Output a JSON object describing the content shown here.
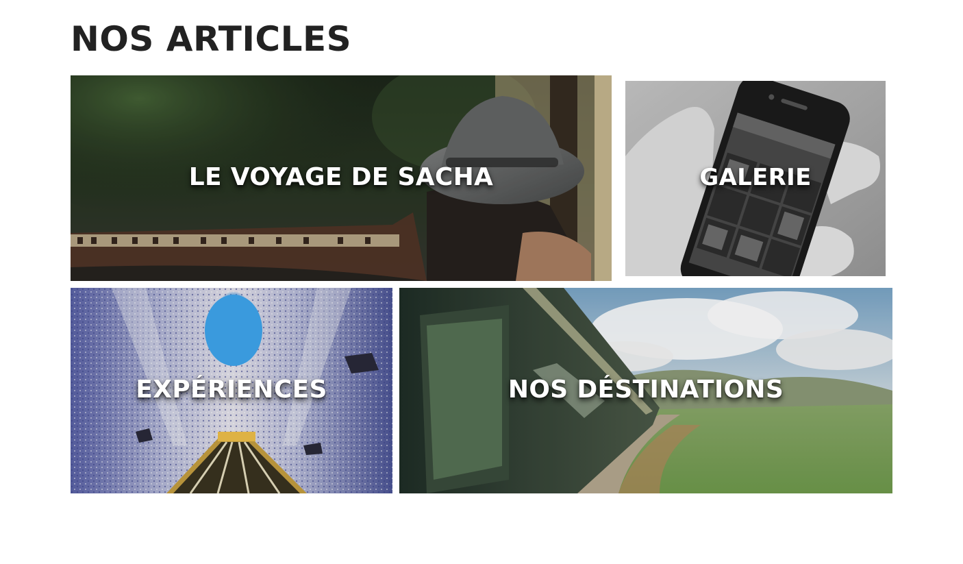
{
  "page": {
    "section_title": "NOS ARTICLES"
  },
  "articles": [
    {
      "label": "LE VOYAGE DE SACHA",
      "image": "woman-hat-train-window-photo"
    },
    {
      "label": "GALERIE",
      "image": "hand-holding-smartphone-photo"
    },
    {
      "label": "EXPÉRIENCES",
      "image": "subway-escalator-tunnel-photo"
    },
    {
      "label": "NOS DÉSTINATIONS",
      "image": "train-countryside-photo"
    }
  ],
  "colors": {
    "title": "#222222",
    "label": "#ffffff"
  }
}
